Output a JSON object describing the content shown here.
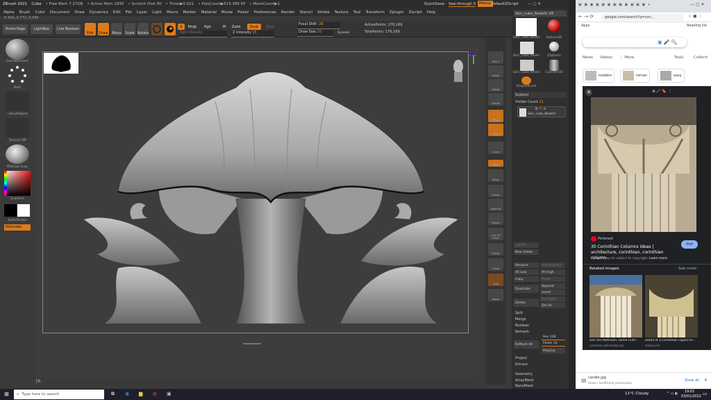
{
  "zbrush": {
    "title": "ZBrush 2021",
    "doc": "Cube",
    "status": [
      "• Free Mem 7.27GB",
      "• Active Mem 2995",
      "• Scratch Disk 80",
      "• Timer▶5.021",
      "• PolyCount▶514.389 KP",
      "• MeshCount▶1"
    ],
    "quicksave": "QuickSave",
    "seethrough": "See-through  0",
    "menus_btn": "Menus",
    "default_script": "DefaultZScript",
    "menu_items": [
      "Alpha",
      "Brush",
      "Color",
      "Document",
      "Draw",
      "Dynamics",
      "Edit",
      "File",
      "Layer",
      "Light",
      "Macro",
      "Marker",
      "Material",
      "Movie",
      "Picker",
      "Preferences",
      "Render",
      "Stencil",
      "Stroke",
      "Texture",
      "Tool",
      "Transform",
      "Zplugin",
      "Zscript",
      "Help"
    ],
    "coords": "0.304,-0.772,-0.096",
    "shelf": {
      "home_page": "Home Page",
      "lightbox": "LightBox",
      "live_boolean": "Live Boolean",
      "edit": "Edit",
      "draw": "Draw",
      "move": "Move",
      "scale": "Scale",
      "rotate": "Rotate",
      "a": "A",
      "mrgb": "Mrgb",
      "rgb": "Rgb",
      "m": "M",
      "zadd": "Zadd",
      "zsub": "Zsub",
      "zcut": "Zcut",
      "rgb_intensity": "Rgb Intensity",
      "z_intensity_label": "Z Intensity",
      "z_intensity_value": "15",
      "focal_shift_label": "Focal Shift",
      "focal_shift_value": "-26",
      "draw_size_label": "Draw Size",
      "draw_size_value": "20",
      "dynamic": "Dynamic",
      "active_points": "ActivePoints: 176,169",
      "total_points": "TotalPoints: 176,169"
    },
    "left_tray": [
      "DamStandard",
      "Dots",
      "~BrushAlpha",
      "Texture Off",
      "MatCap Gray",
      "Gradient",
      "SwitchColor",
      "Alternate"
    ],
    "right_icons": [
      "SPix 3",
      "Zoom",
      "Actual",
      "AAHalf",
      "Persp",
      "Floor",
      "L.Sym",
      "Qxyz",
      "Move",
      "Frame",
      "Zoom3D",
      "Rotate",
      "Line Fill PolyF",
      "Transp",
      "Ghost",
      "Solo",
      "Xpose"
    ],
    "tool_panel": {
      "current_tool": "Skin_cube_NewUV: 48",
      "thumbs": [
        "Skin_cube_NewU",
        "Sphere3D",
        "Skin_cube_NewU",
        "ZSphere",
        "Skin_cube_NewU",
        "Cylinder3D",
        "SimpleBrush"
      ],
      "subtool": "Subtool",
      "visible_count_label": "Visible Count",
      "visible_count_value": "11",
      "subtool_item": "Skin_cube_NewUV",
      "list_all": "List All",
      "new_folder": "New Folder",
      "rename": "Rename",
      "auto_reorder": "AutoReorder",
      "all_low": "All Low",
      "all_high": "All High",
      "copy": "Copy",
      "paste": "Paste",
      "append": "Append",
      "duplicate": "Duplicate",
      "insert": "Insert",
      "del_other": "Del Other",
      "delete": "Delete",
      "del_all": "Del All",
      "split": "Split",
      "merge": "Merge",
      "boolean": "Boolean",
      "remesh": "Remesh",
      "res_label": "Res",
      "res_value": "128",
      "polish_label": "Polish",
      "polish_value": "10",
      "remesh_all": "ReMesh All",
      "polygrp": "PolyGrp",
      "project": "Project",
      "extract": "Extract",
      "geometry": "Geometry",
      "arraymesh": "ArrayMesh",
      "nanomesh": "NanoMesh",
      "layers": "Layers"
    },
    "bottom_text": "[R"
  },
  "chrome": {
    "url": "google.com/search?q=cori...",
    "bookmark": "Apps",
    "reading_list": "Reading list",
    "tabs_filter": [
      "News",
      "Videos",
      "⋮ More"
    ],
    "tools": "Tools",
    "collections": "Collecti",
    "chips": [
      "modern",
      "roman",
      "easy"
    ],
    "source": "Pinterest",
    "result_title": "30 Corinthian Columns ideas | architecture, corinthian, corinthian column",
    "visit": "Visit",
    "copyright": "Images may be subject to copyright.",
    "learn_more": "Learn more",
    "related": "Related images",
    "see_more": "See more",
    "related_items": [
      {
        "caption": "File:The Pantheon, Rome (149...",
        "source": "commons.wikimedia.org"
      },
      {
        "caption": "Detail of a Corinthian capital to...",
        "source": "alamy.com"
      }
    ],
    "download_name": "candle.jpg",
    "download_status": "Failed - Insufficient permissions",
    "show_all": "Show all"
  },
  "taskbar": {
    "search_placeholder": "Type here to search",
    "weather": "11°C  Cloudy",
    "time": "19:01",
    "date": "03/01/2022"
  }
}
